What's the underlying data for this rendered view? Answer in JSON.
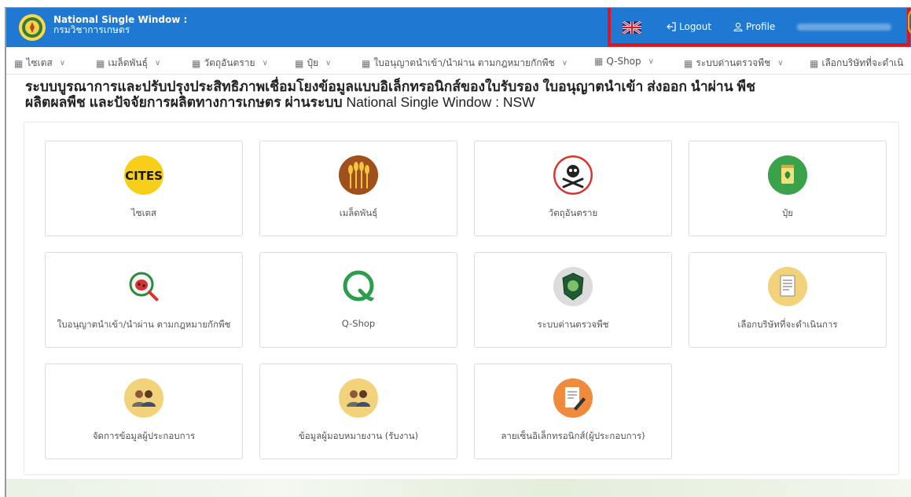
{
  "header": {
    "app_title": "National Single Window :",
    "app_subtitle": "กรมวิชาการเกษตร",
    "logout_label": "Logout",
    "profile_label": "Profile",
    "color": "#1f78d1",
    "highlight_color": "#e0141e"
  },
  "menu": {
    "items": [
      {
        "label": "ไซเตส"
      },
      {
        "label": "เมล็ดพันธุ์"
      },
      {
        "label": "วัตถุอันตราย"
      },
      {
        "label": "ปุ๋ย"
      },
      {
        "label": "ใบอนุญาตนำเข้า/นำผ่าน ตามกฎหมายกักพืช"
      },
      {
        "label": "Q-Shop"
      },
      {
        "label": "ระบบด่านตรวจพืช"
      },
      {
        "label": "เลือกบริษัทที่จะดำเนิ"
      }
    ]
  },
  "page": {
    "heading_line1": "ระบบบูรณาการและปรับปรุงประสิทธิภาพเชื่อมโยงข้อมูลแบบอิเล็กทรอนิกส์ของใบรับรอง ใบอนุญาตนำเข้า ส่งออก นำผ่าน พืช",
    "heading_line2_thai": "ผลิตผลพืช และปัจจัยการผลิตทางการเกษตร ผ่านระบบ",
    "heading_line2_nsw": "National Single Window : NSW"
  },
  "cards": [
    {
      "label": "ไซเตส",
      "icon": "cites-icon"
    },
    {
      "label": "เมล็ดพันธุ์",
      "icon": "wheat-icon"
    },
    {
      "label": "วัตถุอันตราย",
      "icon": "skull-icon"
    },
    {
      "label": "ปุ๋ย",
      "icon": "fertilizer-icon"
    },
    {
      "label": "ใบอนุญาตนำเข้า/นำผ่าน ตามกฎหมายกักพืช",
      "icon": "ladybug-icon"
    },
    {
      "label": "Q-Shop",
      "icon": "q-shop-icon"
    },
    {
      "label": "ระบบด่านตรวจพืช",
      "icon": "badge-icon"
    },
    {
      "label": "เลือกบริษัทที่จะดำเนินการ",
      "icon": "document-icon"
    },
    {
      "label": "จัดการข้อมูลผู้ประกอบการ",
      "icon": "users-icon"
    },
    {
      "label": "ข้อมูลผู้มอบหมายงาน (รับงาน)",
      "icon": "users-icon"
    },
    {
      "label": "ลายเซ็นอิเล็กทรอนิกส์(ผู้ประกอบการ)",
      "icon": "signature-icon"
    }
  ]
}
